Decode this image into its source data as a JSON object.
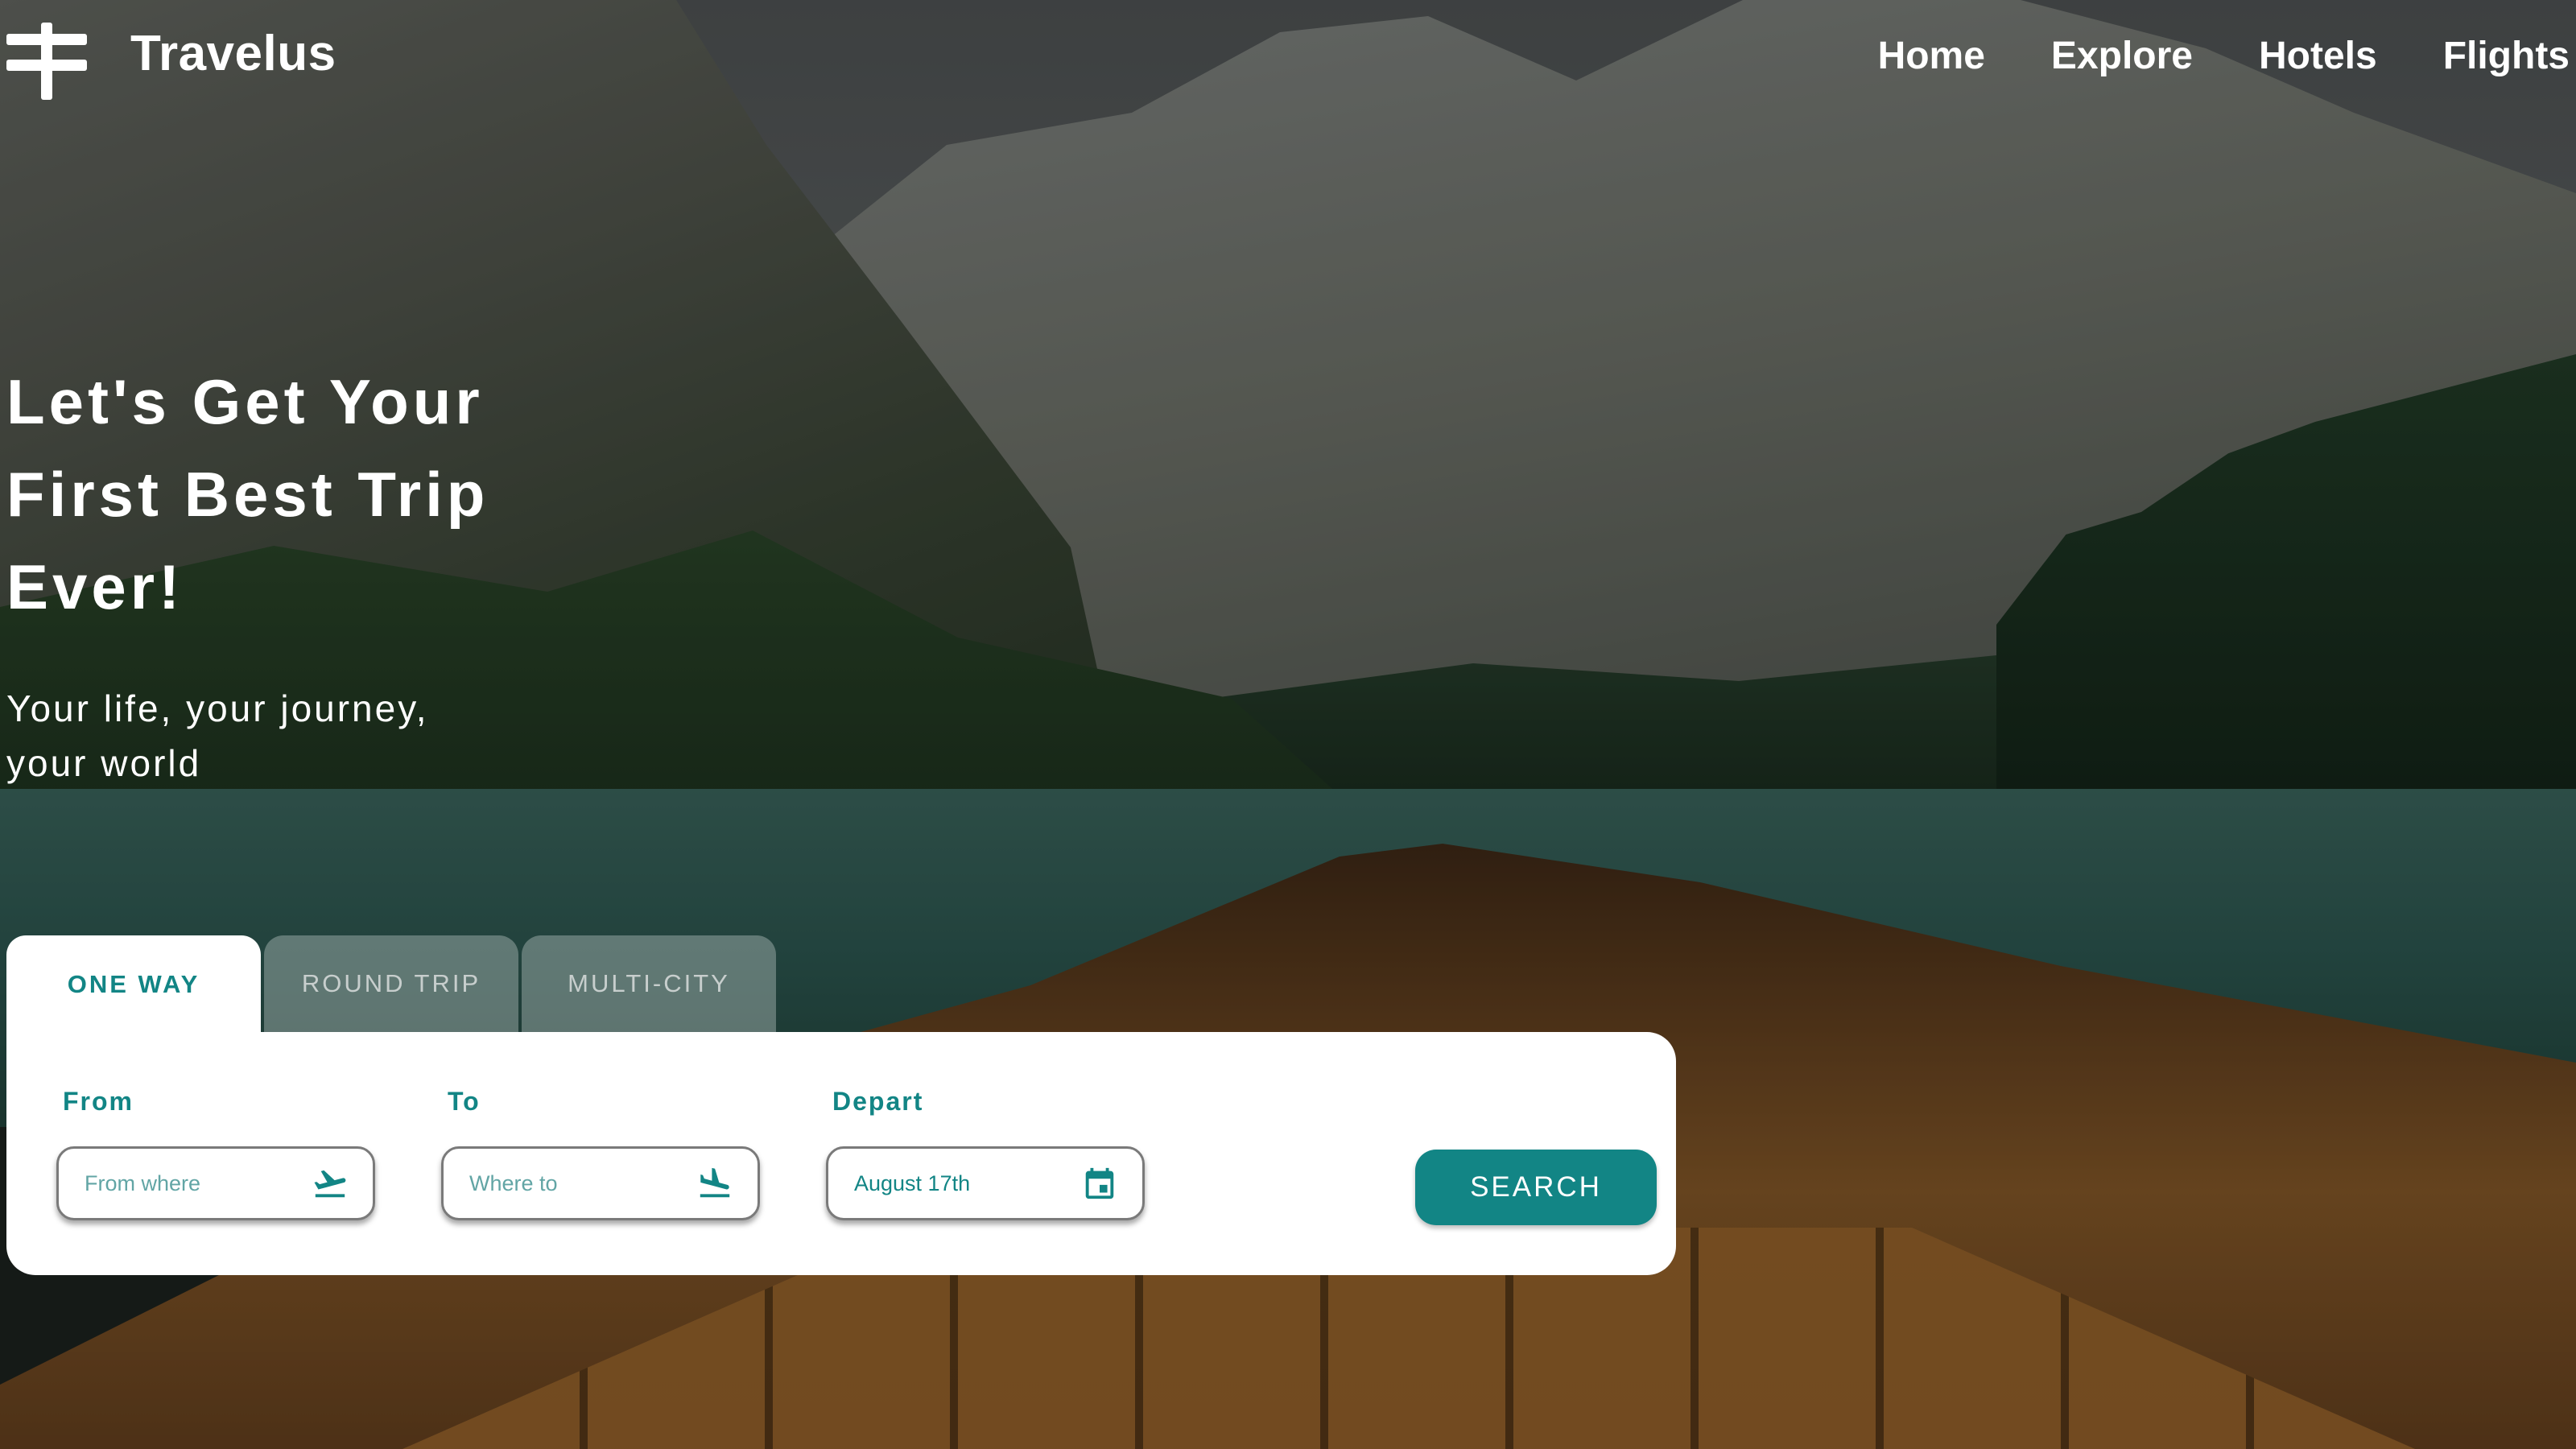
{
  "brand": {
    "name": "Travelus",
    "icon": "signpost-icon"
  },
  "nav": {
    "items": [
      {
        "label": "Home"
      },
      {
        "label": "Explore"
      },
      {
        "label": "Hotels"
      },
      {
        "label": "Flights"
      }
    ]
  },
  "hero": {
    "title_lines": [
      "Let's Get Your",
      "First Best Trip",
      "Ever!"
    ],
    "subtitle_lines": [
      "Your life, your journey,",
      "your world"
    ]
  },
  "search": {
    "tabs": [
      {
        "label": "One Way",
        "active": true
      },
      {
        "label": "Round Trip",
        "active": false
      },
      {
        "label": "Multi-City",
        "active": false
      }
    ],
    "fields": {
      "from": {
        "label": "From",
        "placeholder": "From where",
        "icon": "airplane-takeoff-icon"
      },
      "to": {
        "label": "To",
        "placeholder": "Where to",
        "icon": "airplane-landing-icon"
      },
      "depart": {
        "label": "Depart",
        "value": "August 17th",
        "icon": "calendar-icon"
      }
    },
    "button_label": "Search"
  },
  "colors": {
    "accent": "#128585",
    "panel_background": "#ffffff",
    "text_on_image": "#ffffff"
  }
}
